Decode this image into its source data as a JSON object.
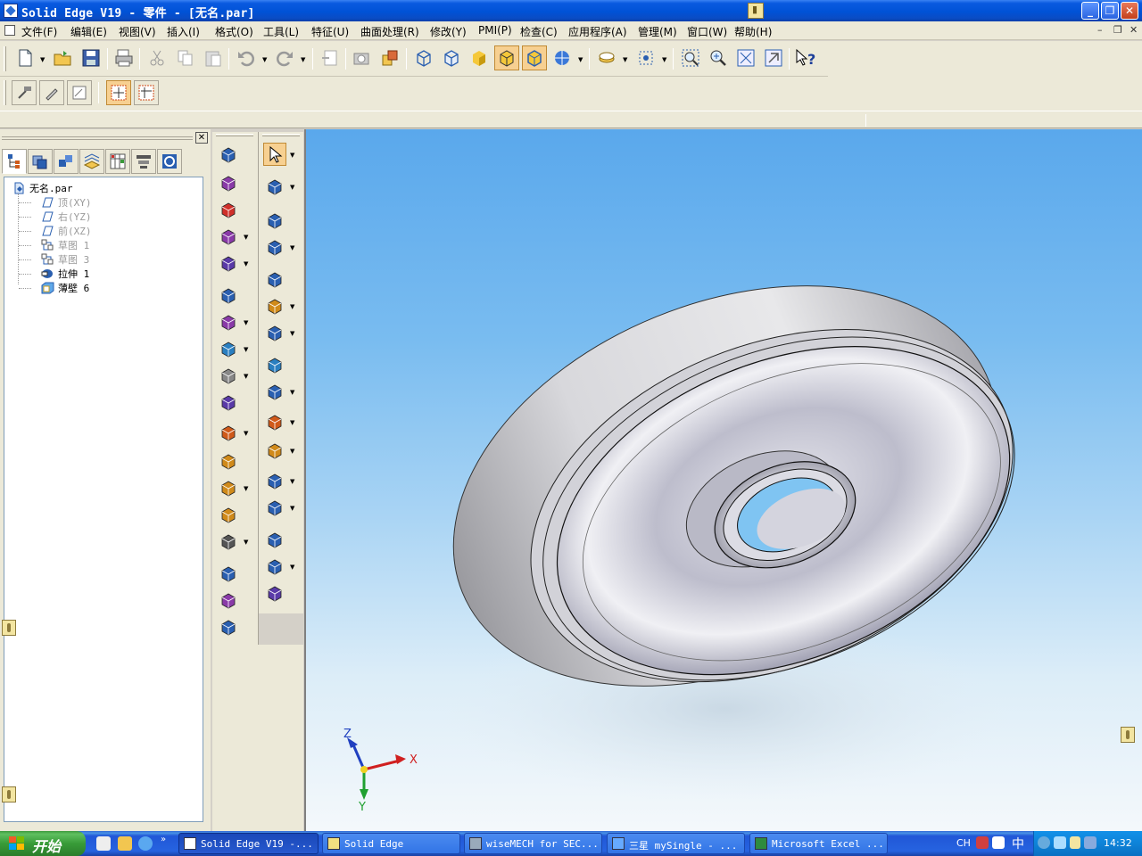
{
  "window": {
    "title": "Solid Edge V19 - 零件 - [无名.par]"
  },
  "menu": {
    "items": [
      "文件(F)",
      "编辑(E)",
      "视图(V)",
      "插入(I)",
      "格式(O)",
      "工具(L)",
      "特征(U)",
      "曲面处理(R)",
      "修改(Y)",
      "PMI(P)",
      "检查(C)",
      "应用程序(A)",
      "管理(M)",
      "窗口(W)",
      "帮助(H)"
    ]
  },
  "toolbar": {
    "standard": [
      "new",
      "open",
      "save",
      "print",
      "cut",
      "copy",
      "paste",
      "undo",
      "redo",
      "properties",
      "render",
      "view-cube",
      "view-box",
      "shaded",
      "shaded-edges",
      "visible-edges",
      "sphere-view",
      "layers",
      "select-view",
      "zoom-area",
      "zoom",
      "fit",
      "pan",
      "help"
    ]
  },
  "feature_tree": {
    "root": "无名.par",
    "items": [
      {
        "label": "顶(XY)",
        "dim": true,
        "icon": "plane"
      },
      {
        "label": "右(YZ)",
        "dim": true,
        "icon": "plane"
      },
      {
        "label": "前(XZ)",
        "dim": true,
        "icon": "plane"
      },
      {
        "label": "草图 1",
        "dim": true,
        "icon": "sketch"
      },
      {
        "label": "草图 3",
        "dim": true,
        "icon": "sketch"
      },
      {
        "label": "拉伸 1",
        "dim": false,
        "icon": "extrude"
      },
      {
        "label": "薄壁 6",
        "dim": false,
        "icon": "thinwall"
      }
    ]
  },
  "triad": {
    "x": "X",
    "y": "Y",
    "z": "Z"
  },
  "taskbar": {
    "start_label": "开始",
    "tasks": [
      {
        "label": "Solid Edge V19 -...",
        "active": true
      },
      {
        "label": "Solid Edge",
        "active": false
      },
      {
        "label": "wiseMECH for SEC...",
        "active": false
      },
      {
        "label": "三星 mySingle - ...",
        "active": false
      },
      {
        "label": "Microsoft Excel ...",
        "active": false
      }
    ],
    "ime": "CH",
    "ime_mode": "中",
    "clock": "14:32"
  },
  "colors": {
    "accent": "#0a5ae0",
    "viewport_top": "#5aa8ec",
    "viewport_bottom": "#f4f8fb",
    "part_gray": "#c8c8d0"
  }
}
